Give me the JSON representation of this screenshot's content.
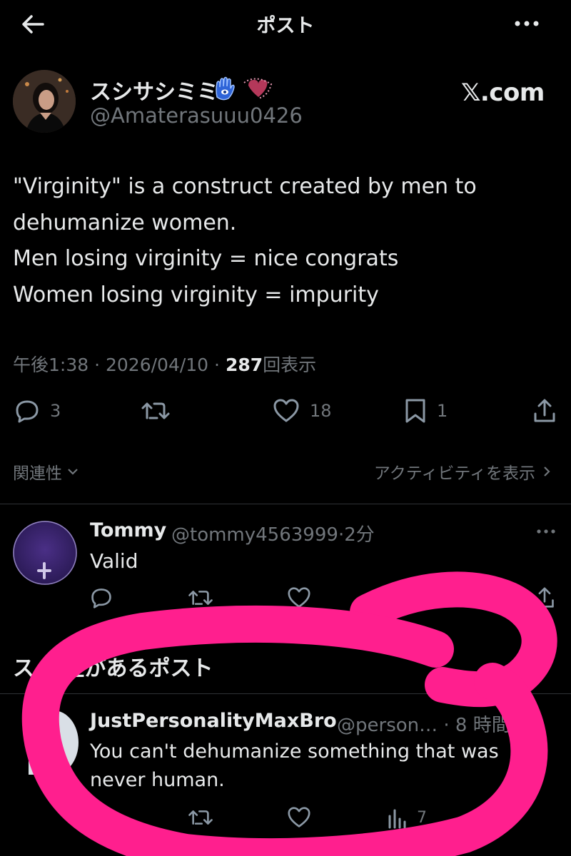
{
  "topbar": {
    "title": "ポスト",
    "back_icon": "arrow-left-icon",
    "more_icon": "more-horizontal-icon"
  },
  "post": {
    "author_name": "スシサシミミ",
    "author_handle": "@Amaterasuuu0426",
    "brand_text": "𝕏.com",
    "lines": [
      "\"Virginity\" is a construct created by men to",
      "dehumanize women.",
      "Men losing virginity = nice congrats",
      "Women losing virginity = impurity"
    ],
    "time": "午後1:38",
    "separator": "·",
    "date": "2026/04/10",
    "views_count": "287",
    "views_label": "回表示",
    "replies": "3",
    "likes": "18",
    "bookmarks": "1"
  },
  "filters": {
    "relevance": "関連性",
    "activity": "アクティビティを表示"
  },
  "reply": {
    "name": "Tommy",
    "handle": "@tommy4563999",
    "time": "2分",
    "text": "Valid"
  },
  "section": {
    "heading": "ス          能性があるポスト"
  },
  "third": {
    "name": "JustPersonalityMaxBro",
    "handle": "@person… · 8 時間",
    "lines": [
      "You can't dehumanize something that was",
      "never human."
    ],
    "views": "7"
  },
  "colors": {
    "background": "#000000",
    "text": "#e7e9ea",
    "muted": "#71767b",
    "marker": "#ff1f8e",
    "divider": "#2f3336"
  }
}
